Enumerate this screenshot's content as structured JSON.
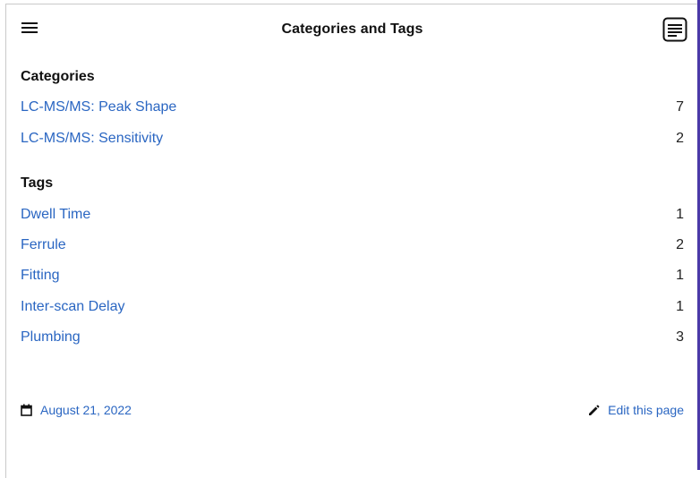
{
  "header": {
    "title": "Categories and Tags",
    "menu_icon": "hamburger-menu-icon",
    "toc_icon": "table-of-contents-icon"
  },
  "categories": {
    "heading": "Categories",
    "items": [
      {
        "label": "LC-MS/MS: Peak Shape",
        "count": "7"
      },
      {
        "label": "LC-MS/MS: Sensitivity",
        "count": "2"
      }
    ]
  },
  "tags": {
    "heading": "Tags",
    "items": [
      {
        "label": "Dwell Time",
        "count": "1"
      },
      {
        "label": "Ferrule",
        "count": "2"
      },
      {
        "label": "Fitting",
        "count": "1"
      },
      {
        "label": "Inter-scan Delay",
        "count": "1"
      },
      {
        "label": "Plumbing",
        "count": "3"
      }
    ]
  },
  "footer": {
    "date": "August 21, 2022",
    "date_icon": "calendar-icon",
    "edit_label": "Edit this page",
    "edit_icon": "pencil-icon"
  },
  "colors": {
    "link": "#2a66c2",
    "accent": "#4b3aa8"
  }
}
